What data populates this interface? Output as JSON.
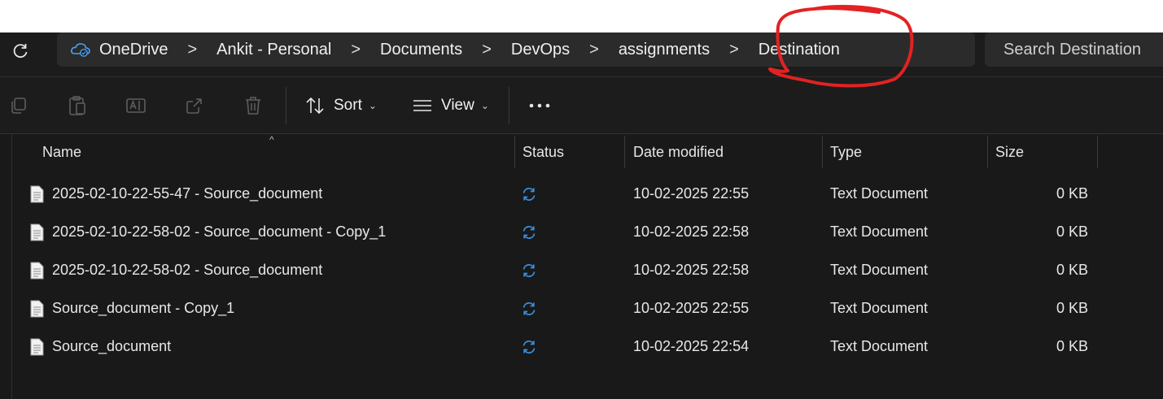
{
  "breadcrumb": {
    "items": [
      "OneDrive",
      "Ankit - Personal",
      "Documents",
      "DevOps",
      "assignments",
      "Destination"
    ],
    "separator": ">"
  },
  "search": {
    "placeholder": "Search Destination"
  },
  "toolbar": {
    "sort_label": "Sort",
    "view_label": "View"
  },
  "columns": {
    "name": "Name",
    "status": "Status",
    "date": "Date modified",
    "type": "Type",
    "size": "Size"
  },
  "files": [
    {
      "name": "2025-02-10-22-55-47 - Source_document",
      "date": "10-02-2025 22:55",
      "type": "Text Document",
      "size": "0 KB"
    },
    {
      "name": "2025-02-10-22-58-02 - Source_document - Copy_1",
      "date": "10-02-2025 22:58",
      "type": "Text Document",
      "size": "0 KB"
    },
    {
      "name": "2025-02-10-22-58-02 - Source_document",
      "date": "10-02-2025 22:58",
      "type": "Text Document",
      "size": "0 KB"
    },
    {
      "name": "Source_document - Copy_1",
      "date": "10-02-2025 22:55",
      "type": "Text Document",
      "size": "0 KB"
    },
    {
      "name": "Source_document",
      "date": "10-02-2025 22:54",
      "type": "Text Document",
      "size": "0 KB"
    }
  ],
  "colors": {
    "accent": "#3b8fe0",
    "annotation": "#e32222",
    "background": "#191919"
  }
}
